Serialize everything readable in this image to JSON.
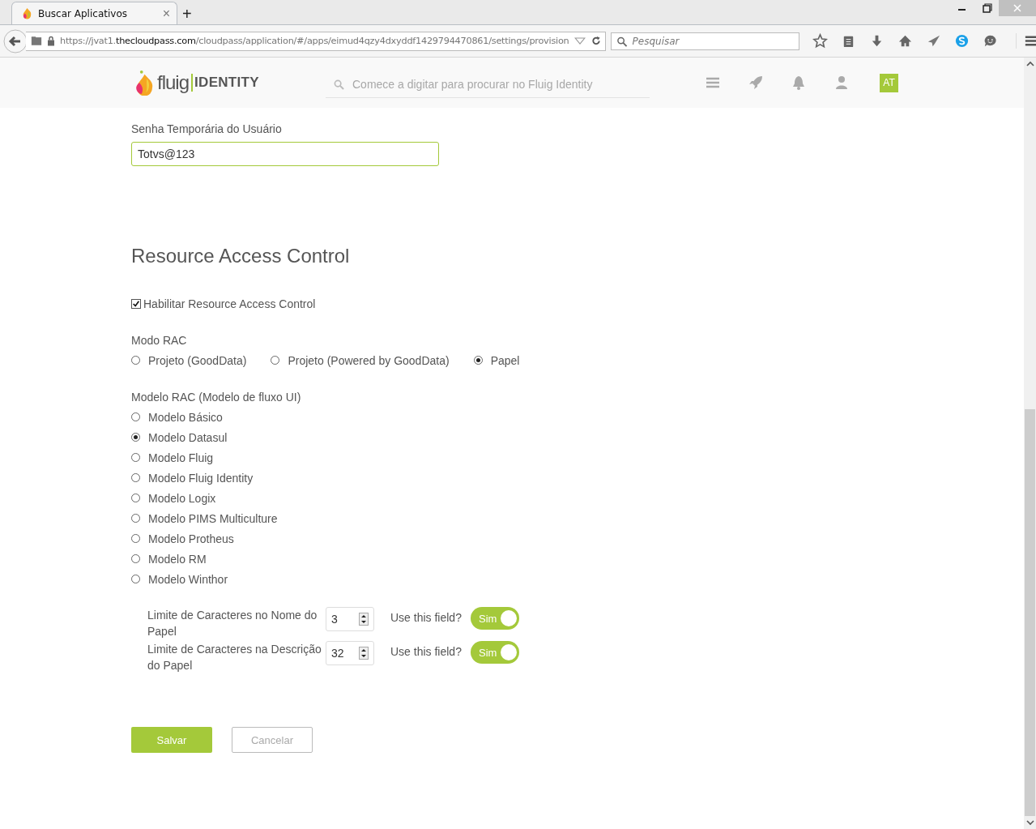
{
  "browser": {
    "tab": {
      "title": "Buscar Aplicativos",
      "close": "×"
    },
    "new_tab": "+",
    "url": "https://jvat1.**thecloudpass.com**/cloudpass/application/#/apps/eimud4qzy4dxyddf1429794470861/settings/provision",
    "search": {
      "placeholder": "Pesquisar"
    }
  },
  "header": {
    "logo": {
      "brand": "fluig",
      "product": "IDENTITY"
    },
    "search": {
      "placeholder": "Comece a digitar para procurar no Fluig Identity"
    },
    "avatar": "AT"
  },
  "password": {
    "label": "Senha Temporária do Usuário",
    "value": "Totvs@123"
  },
  "section_title": "Resource Access Control",
  "enable": {
    "label": "Habilitar Resource Access Control",
    "checked": true
  },
  "mode": {
    "label": "Modo RAC",
    "options": [
      {
        "label": "Projeto (GoodData)",
        "selected": false
      },
      {
        "label": "Projeto (Powered by GoodData)",
        "selected": false
      },
      {
        "label": "Papel",
        "selected": true
      }
    ]
  },
  "model": {
    "label": "Modelo RAC (Modelo de fluxo UI)",
    "options": [
      {
        "label": "Modelo Básico",
        "selected": false
      },
      {
        "label": "Modelo Datasul",
        "selected": true
      },
      {
        "label": "Modelo Fluig",
        "selected": false
      },
      {
        "label": "Modelo Fluig Identity",
        "selected": false
      },
      {
        "label": "Modelo Logix",
        "selected": false
      },
      {
        "label": "Modelo PIMS Multiculture",
        "selected": false
      },
      {
        "label": "Modelo Protheus",
        "selected": false
      },
      {
        "label": "Modelo RM",
        "selected": false
      },
      {
        "label": "Modelo Winthor",
        "selected": false
      }
    ]
  },
  "limits": [
    {
      "label": "Limite de Caracteres no Nome do Papel",
      "value": "3",
      "question": "Use this field?",
      "toggle": {
        "label": "Sim",
        "on": true
      }
    },
    {
      "label": "Limite de Caracteres na Descrição do Papel",
      "value": "32",
      "question": "Use this field?",
      "toggle": {
        "label": "Sim",
        "on": true
      }
    }
  ],
  "buttons": {
    "save": "Salvar",
    "cancel": "Cancelar"
  }
}
